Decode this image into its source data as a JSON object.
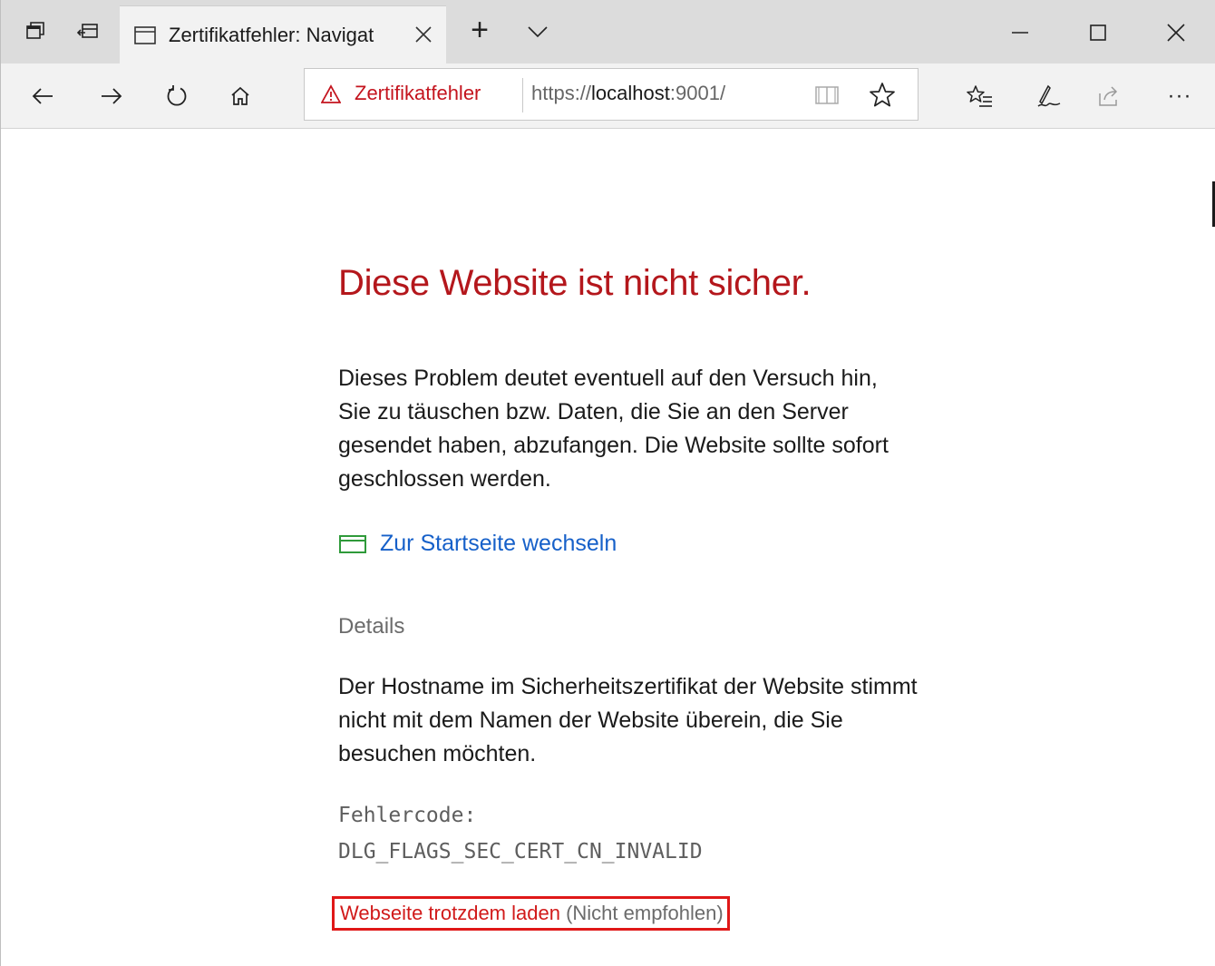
{
  "tabstrip": {
    "tab_title": "Zertifikatfehler: Navigat",
    "new_tab_label": "+",
    "icons": [
      "tab-preview-icon",
      "set-tabs-aside-icon",
      "tab-page-icon",
      "close-icon",
      "chevron-down-icon"
    ]
  },
  "window_controls": [
    "minimize-icon",
    "maximize-icon",
    "close-icon"
  ],
  "navbar": {
    "icons": [
      "back-arrow-icon",
      "forward-arrow-icon",
      "refresh-icon",
      "home-icon",
      "reading-view-icon",
      "favorite-star-icon",
      "favorites-list-icon",
      "pen-notes-icon",
      "share-icon",
      "more-dots-icon"
    ],
    "more_label": "···"
  },
  "address": {
    "warning_text": "Zertifikatfehler",
    "url_prefix": "https://",
    "url_host": "localhost",
    "url_suffix": ":9001/"
  },
  "page": {
    "title": "Diese Website ist nicht sicher.",
    "description": "Dieses Problem deutet eventuell auf den Versuch hin, Sie zu täuschen bzw. Daten, die Sie an den Server gesendet haben, abzufangen. Die Website sollte sofort geschlossen werden.",
    "home_link": "Zur Startseite wechseln",
    "details_label": "Details",
    "details_text": "Der Hostname im Sicherheitszertifikat der Website stimmt nicht mit dem Namen der Website überein, die Sie besuchen möchten.",
    "error_code_label": "Fehlercode:",
    "error_code": "DLG_FLAGS_SEC_CERT_CN_INVALID",
    "proceed_link": "Webseite trotzdem laden",
    "proceed_note": "(Nicht empfohlen)"
  },
  "colors": {
    "title_red": "#b4171c",
    "link_blue": "#1660c9",
    "highlight_border": "#e01818",
    "home_icon_green": "#2f9a3a"
  }
}
